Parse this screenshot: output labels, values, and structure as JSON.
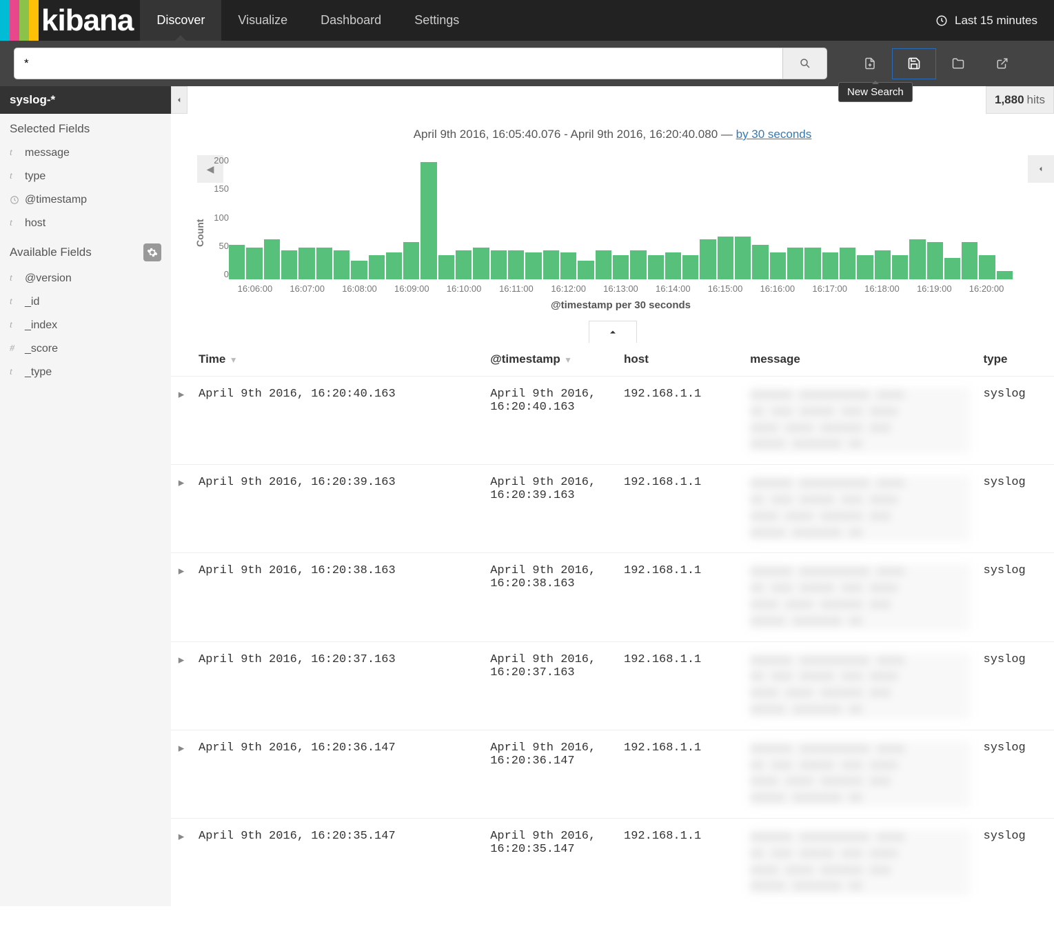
{
  "app": "kibana",
  "nav": {
    "tabs": [
      "Discover",
      "Visualize",
      "Dashboard",
      "Settings"
    ],
    "active": 0
  },
  "timepicker": "Last 15 minutes",
  "search": {
    "query": "*"
  },
  "tooltip": "New Search",
  "index_pattern": "syslog-*",
  "hits": {
    "count": "1,880",
    "label": "hits"
  },
  "sidebar": {
    "selected_header": "Selected Fields",
    "selected": [
      {
        "icon": "t",
        "name": "message"
      },
      {
        "icon": "t",
        "name": "type"
      },
      {
        "icon": "clock",
        "name": "@timestamp"
      },
      {
        "icon": "t",
        "name": "host"
      }
    ],
    "available_header": "Available Fields",
    "available": [
      {
        "icon": "t",
        "name": "@version"
      },
      {
        "icon": "t",
        "name": "_id"
      },
      {
        "icon": "t",
        "name": "_index"
      },
      {
        "icon": "#",
        "name": "_score"
      },
      {
        "icon": "t",
        "name": "_type"
      }
    ]
  },
  "time_range": {
    "from": "April 9th 2016, 16:05:40.076",
    "to": "April 9th 2016, 16:20:40.080",
    "interval": "by 30 seconds"
  },
  "chart_data": {
    "type": "bar",
    "ylabel": "Count",
    "xlabel": "@timestamp per 30 seconds",
    "ylim": [
      0,
      220
    ],
    "y_ticks": [
      "200",
      "150",
      "100",
      "50",
      "0"
    ],
    "x_ticks": [
      "16:06:00",
      "16:07:00",
      "16:08:00",
      "16:09:00",
      "16:10:00",
      "16:11:00",
      "16:12:00",
      "16:13:00",
      "16:14:00",
      "16:15:00",
      "16:16:00",
      "16:17:00",
      "16:18:00",
      "16:19:00",
      "16:20:00"
    ],
    "values": [
      65,
      60,
      75,
      55,
      60,
      60,
      55,
      35,
      45,
      50,
      70,
      220,
      45,
      55,
      60,
      55,
      55,
      50,
      55,
      50,
      35,
      55,
      45,
      55,
      45,
      50,
      45,
      75,
      80,
      80,
      65,
      50,
      60,
      60,
      50,
      60,
      45,
      55,
      45,
      75,
      70,
      40,
      70,
      45,
      15
    ]
  },
  "table": {
    "columns": [
      "Time",
      "@timestamp",
      "host",
      "message",
      "type"
    ],
    "rows": [
      {
        "time": "April 9th 2016, 16:20:40.163",
        "timestamp": "April 9th 2016, 16:20:40.163",
        "host": "192.168.1.1",
        "type": "syslog"
      },
      {
        "time": "April 9th 2016, 16:20:39.163",
        "timestamp": "April 9th 2016, 16:20:39.163",
        "host": "192.168.1.1",
        "type": "syslog"
      },
      {
        "time": "April 9th 2016, 16:20:38.163",
        "timestamp": "April 9th 2016, 16:20:38.163",
        "host": "192.168.1.1",
        "type": "syslog"
      },
      {
        "time": "April 9th 2016, 16:20:37.163",
        "timestamp": "April 9th 2016, 16:20:37.163",
        "host": "192.168.1.1",
        "type": "syslog"
      },
      {
        "time": "April 9th 2016, 16:20:36.147",
        "timestamp": "April 9th 2016, 16:20:36.147",
        "host": "192.168.1.1",
        "type": "syslog"
      },
      {
        "time": "April 9th 2016, 16:20:35.147",
        "timestamp": "April 9th 2016, 16:20:35.147",
        "host": "192.168.1.1",
        "type": "syslog"
      }
    ]
  }
}
